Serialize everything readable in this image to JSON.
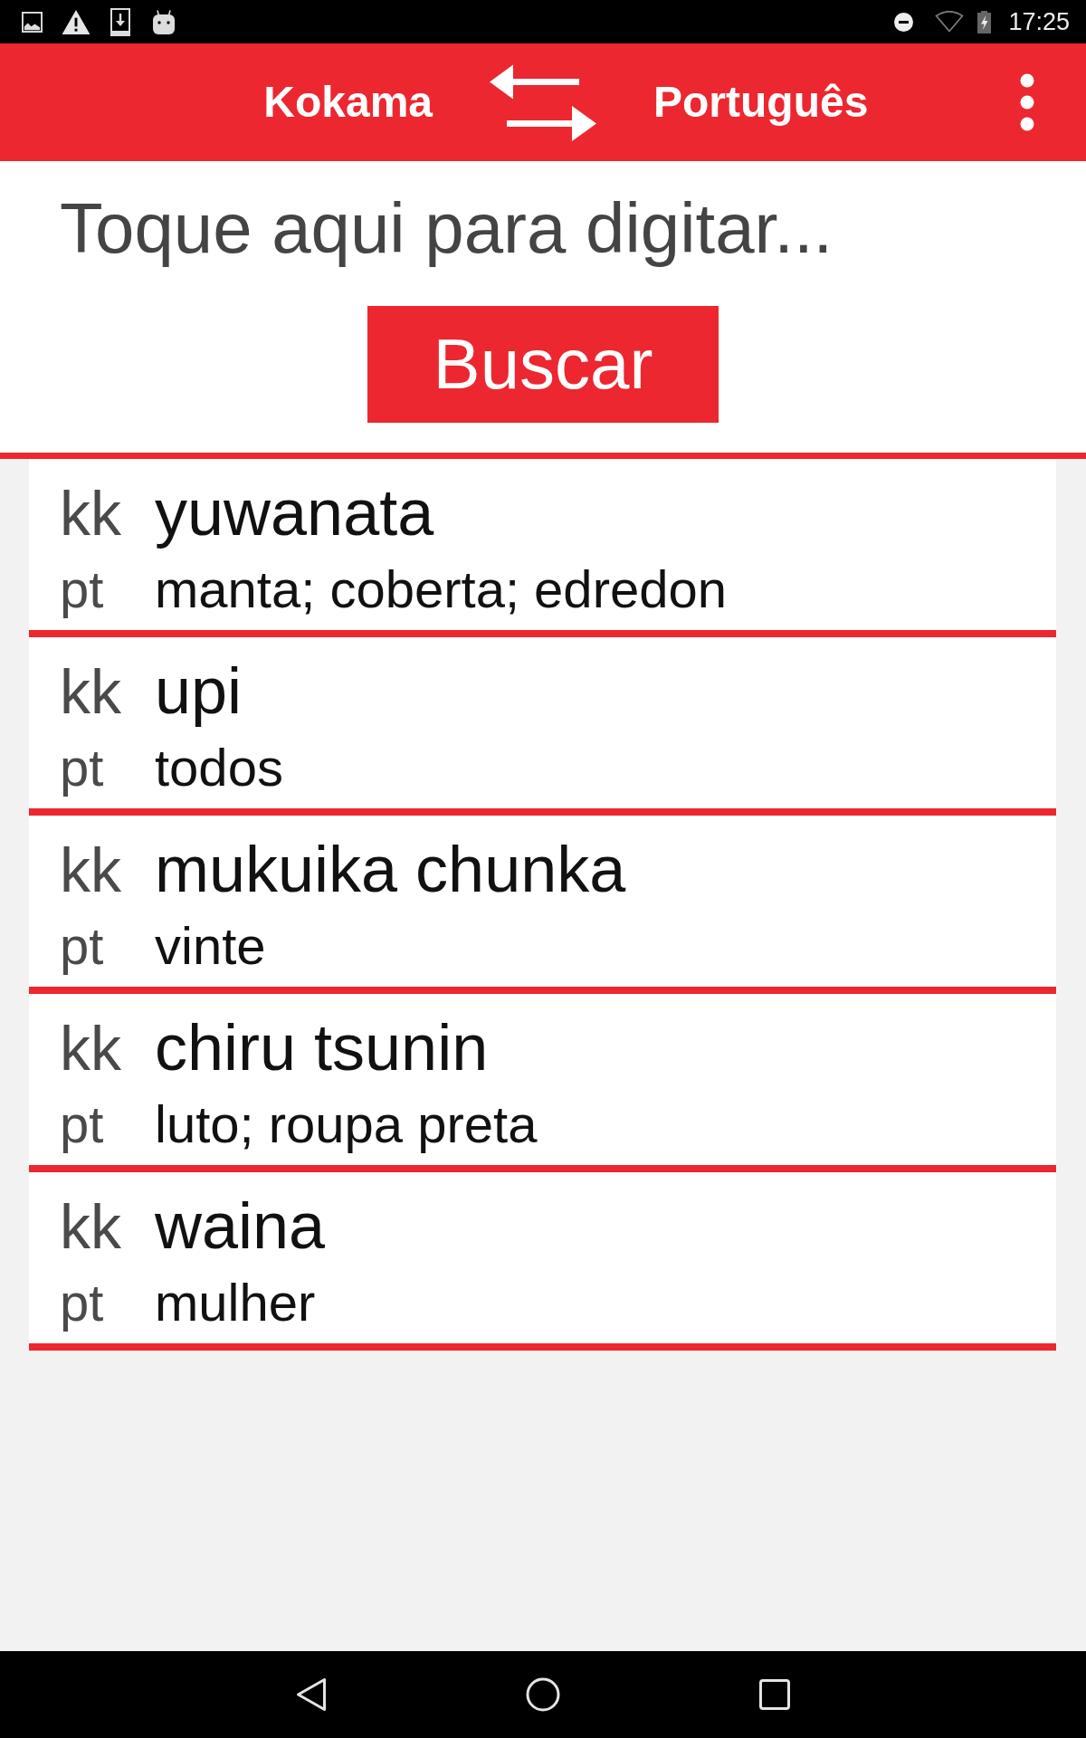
{
  "status_bar": {
    "time": "17:25"
  },
  "app_bar": {
    "source_language": "Kokama",
    "target_language": "Português"
  },
  "search": {
    "placeholder": "Toque aqui para digitar...",
    "button": "Buscar"
  },
  "results": [
    {
      "lines": [
        {
          "kind": "headword",
          "lang": "kk",
          "text": "yuwanata"
        },
        {
          "kind": "translation",
          "lang": "pt",
          "text": "manta; coberta; edredon"
        }
      ]
    },
    {
      "lines": [
        {
          "kind": "headword",
          "lang": "kk",
          "text": "upi"
        },
        {
          "kind": "translation",
          "lang": "pt",
          "text": "todos"
        }
      ]
    },
    {
      "lines": [
        {
          "kind": "headword",
          "lang": "kk",
          "text": "mukuika chunka"
        },
        {
          "kind": "translation",
          "lang": "pt",
          "text": "vinte"
        }
      ]
    },
    {
      "lines": [
        {
          "kind": "headword",
          "lang": "kk",
          "text": "chiru tsunin"
        },
        {
          "kind": "translation",
          "lang": "pt",
          "text": "luto; roupa preta"
        }
      ]
    },
    {
      "lines": [
        {
          "kind": "headword",
          "lang": "kk",
          "text": "waina"
        },
        {
          "kind": "translation",
          "lang": "pt",
          "text": "mulher"
        }
      ]
    }
  ]
}
